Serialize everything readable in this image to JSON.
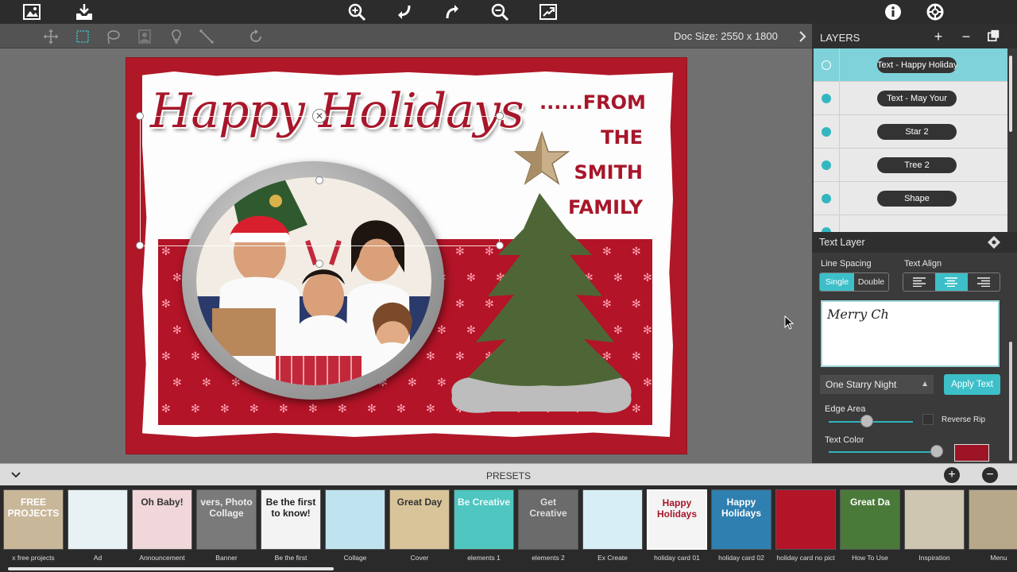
{
  "toolbar": {
    "doc_size": "Doc Size: 2550 x 1800"
  },
  "card": {
    "headline": "Happy Holidays",
    "from_lines": [
      "......FROM",
      "THE",
      "SMITH",
      "FAMILY"
    ]
  },
  "layers": {
    "title": "LAYERS",
    "items": [
      {
        "label": "Text - Happy Holidays",
        "active": true
      },
      {
        "label": "Text - May Your",
        "active": false
      },
      {
        "label": "Star 2",
        "active": false
      },
      {
        "label": "Tree 2",
        "active": false
      },
      {
        "label": "Shape",
        "active": false
      }
    ]
  },
  "text_layer": {
    "title": "Text Layer",
    "line_spacing_label": "Line Spacing",
    "text_align_label": "Text Align",
    "single_label": "Single",
    "double_label": "Double",
    "text_value": "Merry Ch",
    "font_value": "One Starry Night",
    "apply_label": "Apply Text",
    "edge_area_label": "Edge Area",
    "reverse_rip_label": "Reverse Rip",
    "text_color_label": "Text Color",
    "edge_area_value": 0.45,
    "text_color_slider_value": 0.95,
    "text_color": "#9c1426",
    "accent_color": "#3cbfc8"
  },
  "presets": {
    "title": "PRESETS",
    "items": [
      {
        "caption": "x free projects",
        "thumb_text": "FREE PROJECTS",
        "bg": "#c9b79a",
        "fg": "#ffffff"
      },
      {
        "caption": "Ad",
        "thumb_text": "",
        "bg": "#e8f2f5",
        "fg": "#333"
      },
      {
        "caption": "Announcement",
        "thumb_text": "Oh Baby!",
        "bg": "#f1d7da",
        "fg": "#333"
      },
      {
        "caption": "Banner",
        "thumb_text": "vers, Photo Collage",
        "bg": "#7a7a7a",
        "fg": "#eee"
      },
      {
        "caption": "Be the first",
        "thumb_text": "Be the first to know!",
        "bg": "#f3f3f3",
        "fg": "#222"
      },
      {
        "caption": "Collage",
        "thumb_text": "",
        "bg": "#bfe4f0",
        "fg": "#333"
      },
      {
        "caption": "Cover",
        "thumb_text": "Great Day",
        "bg": "#d9c49a",
        "fg": "#333"
      },
      {
        "caption": "elements 1",
        "thumb_text": "Be Creative",
        "bg": "#4fc6c0",
        "fg": "#eafafa"
      },
      {
        "caption": "elements 2",
        "thumb_text": "Get Creative",
        "bg": "#6b6b6b",
        "fg": "#dddddd"
      },
      {
        "caption": "Ex Create",
        "thumb_text": "",
        "bg": "#d6eef4",
        "fg": "#333"
      },
      {
        "caption": "holiday card 01",
        "thumb_text": "Happy Holidays",
        "bg": "#f4f4f4",
        "fg": "#a7162a"
      },
      {
        "caption": "holiday card 02",
        "thumb_text": "Happy Holidays",
        "bg": "#2f7fb0",
        "fg": "#ffffff"
      },
      {
        "caption": "holiday card no pict",
        "thumb_text": "",
        "bg": "#b31427",
        "fg": "#fff"
      },
      {
        "caption": "How To Use",
        "thumb_text": "Great Da",
        "bg": "#4a7a3a",
        "fg": "#fff"
      },
      {
        "caption": "Inspiration",
        "thumb_text": "",
        "bg": "#cfc6b2",
        "fg": "#333"
      },
      {
        "caption": "Menu",
        "thumb_text": "",
        "bg": "#b8a88a",
        "fg": "#333"
      }
    ]
  }
}
